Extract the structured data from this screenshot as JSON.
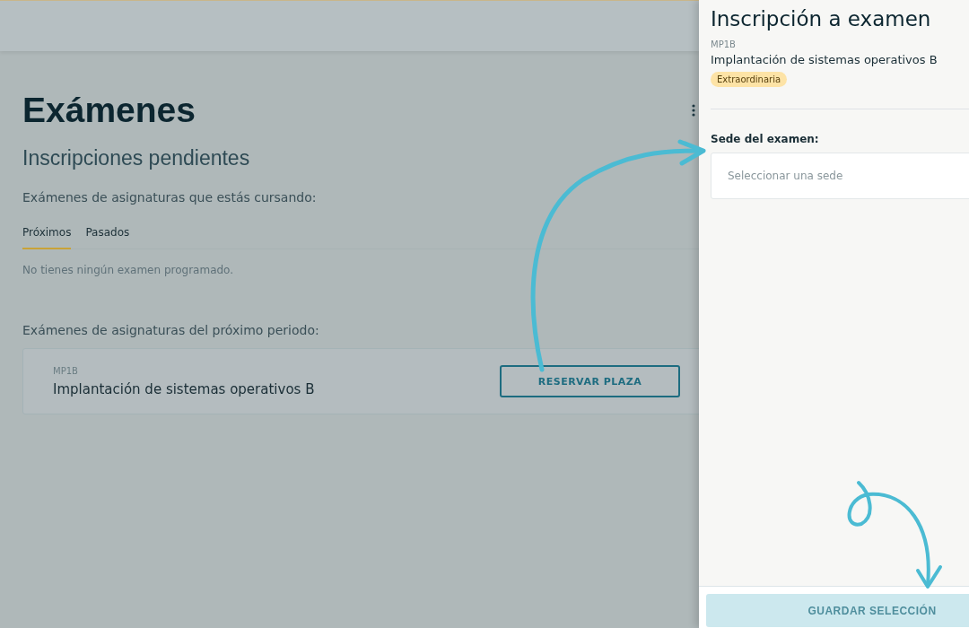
{
  "page": {
    "title": "Exámenes",
    "section": "Inscripciones pendientes",
    "current_label": "Exámenes de asignaturas que estás cursando:",
    "tabs": [
      {
        "label": "Próximos",
        "selected": true
      },
      {
        "label": "Pasados",
        "selected": false
      }
    ],
    "empty_message": "No tienes ningún examen programado.",
    "next_label": "Exámenes de asignaturas del próximo periodo:",
    "courses": [
      {
        "code": "MP1B",
        "name": "Implantación de sistemas operativos B",
        "action": "RESERVAR PLAZA"
      }
    ]
  },
  "panel": {
    "title": "Inscripción a examen",
    "code": "MP1B",
    "name": "Implantación de sistemas operativos B",
    "tag": "Extraordinaria",
    "field_label": "Sede del examen:",
    "field_placeholder": "Seleccionar una sede",
    "save_button": {
      "label": "GUARDAR SELECCIÓN",
      "disabled": true
    }
  }
}
